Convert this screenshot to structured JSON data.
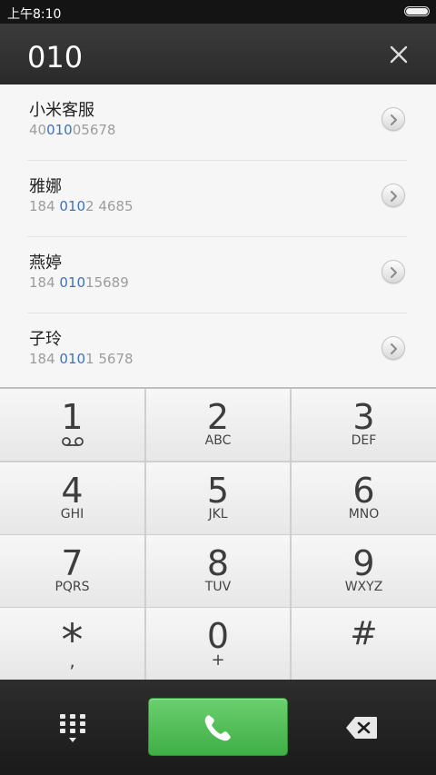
{
  "status_bar": {
    "time": "上午8:10"
  },
  "dialer": {
    "input_value": "010"
  },
  "contacts": [
    {
      "name": "小米客服",
      "number_before": "40",
      "number_match": "010",
      "number_after": "05678"
    },
    {
      "name": "雅娜",
      "number_before": "184 ",
      "number_match": "010",
      "number_after": "2 4685"
    },
    {
      "name": "燕婷",
      "number_before": "184 ",
      "number_match": "010",
      "number_after": "15689"
    },
    {
      "name": "子玲",
      "number_before": "184 ",
      "number_match": "010",
      "number_after": "1 5678"
    }
  ],
  "keypad": {
    "keys": [
      {
        "digit": "1",
        "letters": ""
      },
      {
        "digit": "2",
        "letters": "ABC"
      },
      {
        "digit": "3",
        "letters": "DEF"
      },
      {
        "digit": "4",
        "letters": "GHI"
      },
      {
        "digit": "5",
        "letters": "JKL"
      },
      {
        "digit": "6",
        "letters": "MNO"
      },
      {
        "digit": "7",
        "letters": "PQRS"
      },
      {
        "digit": "8",
        "letters": "TUV"
      },
      {
        "digit": "9",
        "letters": "WXYZ"
      },
      {
        "digit": "*",
        "letters": ","
      },
      {
        "digit": "0",
        "letters": "+"
      },
      {
        "digit": "#",
        "letters": ""
      }
    ]
  },
  "icons": {
    "clear": "close-icon",
    "voicemail": "voicemail-icon",
    "keypad_toggle": "dialpad-icon",
    "call": "phone-icon",
    "backspace": "backspace-icon",
    "detail": "chevron-right-icon"
  },
  "colors": {
    "match_highlight": "#3a72c4",
    "call_button": "#4cbb52",
    "header_bg": "#333333"
  }
}
